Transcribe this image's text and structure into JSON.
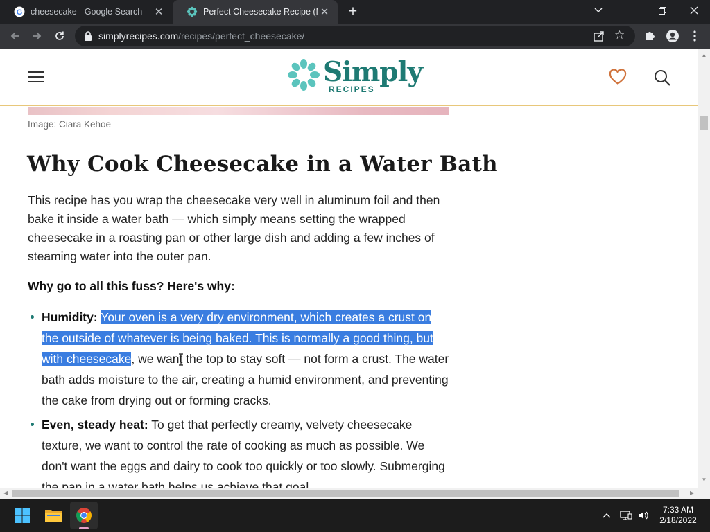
{
  "browser": {
    "tabs": [
      {
        "title": "cheesecake - Google Search",
        "favicon": "google-icon",
        "active": false
      },
      {
        "title": "Perfect Cheesecake Recipe (New",
        "favicon": "simplyrecipes-icon",
        "active": true
      }
    ],
    "url": {
      "domain": "simplyrecipes.com",
      "path": "/recipes/perfect_cheesecake/"
    }
  },
  "site": {
    "logo_word": "Simply",
    "logo_sub": "RECIPES",
    "brand_color": "#1e7a73",
    "heart_color": "#d0733c"
  },
  "article": {
    "caption": "Image: Ciara Kehoe",
    "heading": "Why Cook Cheesecake in a Water Bath",
    "intro": "This recipe has you wrap the cheesecake very well in aluminum foil and then bake it inside a water bath — which simply means setting the wrapped cheesecake in a roasting pan or other large dish and adding a few inches of steaming water into the outer pan.",
    "question": "Why go to all this fuss? Here's why:",
    "bullets": [
      {
        "label": "Humidity:",
        "selected": "Your oven is a very dry environment, which creates a crust on the outside of whatever is being baked. This is normally a good thing, but with cheesecake",
        "text": ", we want the top to stay soft — not form a crust. The water bath adds moisture to the air, creating a humid environment, and preventing the cake from drying out or forming cracks."
      },
      {
        "label": "Even, steady heat:",
        "selected": "",
        "text": " To get that perfectly creamy, velvety cheesecake texture, we want to control the rate of cooking as much as possible. We don't want the eggs and dairy to cook too quickly or too slowly. Submerging the pan in a water bath helps us achieve that goal."
      }
    ],
    "selection_color": "#3a7de0"
  },
  "taskbar": {
    "time": "7:33 AM",
    "date": "2/18/2022"
  }
}
